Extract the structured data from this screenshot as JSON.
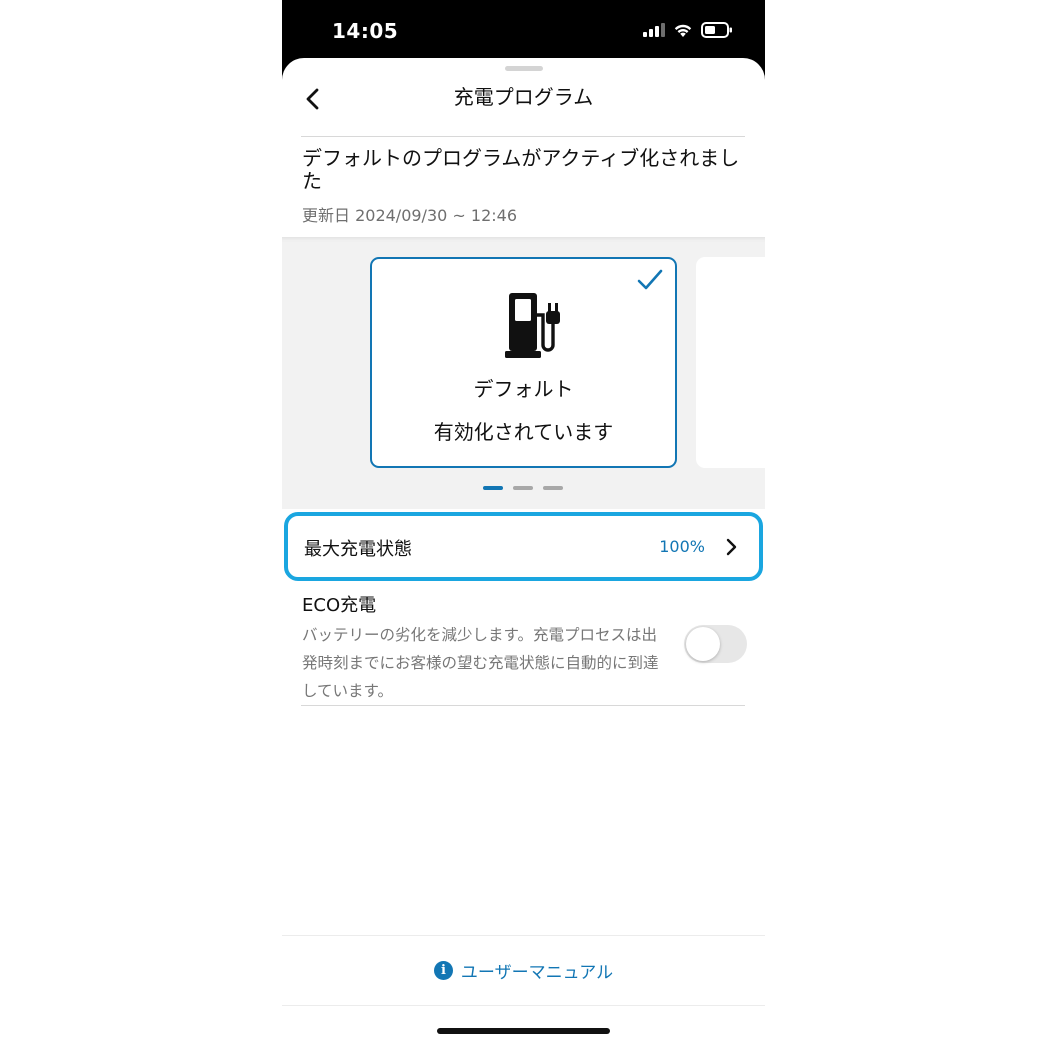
{
  "status_bar": {
    "time": "14:05",
    "icons": [
      "cellular-signal-icon",
      "wifi-icon",
      "battery-icon"
    ]
  },
  "header": {
    "title": "充電プログラム",
    "back_icon": "chevron-left-icon"
  },
  "program_status": {
    "heading": "デフォルトのプログラムがアクティブ化されました",
    "updated": "更新日 2024/09/30 ~ 12:46"
  },
  "carousel": {
    "cards": [
      {
        "name": "デフォルト",
        "status": "有効化されています",
        "icon": "ev-charger-icon",
        "selected": true
      }
    ],
    "pages": 3,
    "active_page": 0
  },
  "max_soc": {
    "label": "最大充電状態",
    "value": "100%"
  },
  "eco_charging": {
    "title": "ECO充電",
    "description": "バッテリーの劣化を減少します。充電プロセスは出発時刻までにお客様の望む充電状態に自動的に到達しています。",
    "enabled": false
  },
  "footer": {
    "manual_label": "ユーザーマニュアル",
    "icon": "info-icon"
  },
  "colors": {
    "accent": "#1276b4",
    "highlight": "#1aa6e0"
  }
}
